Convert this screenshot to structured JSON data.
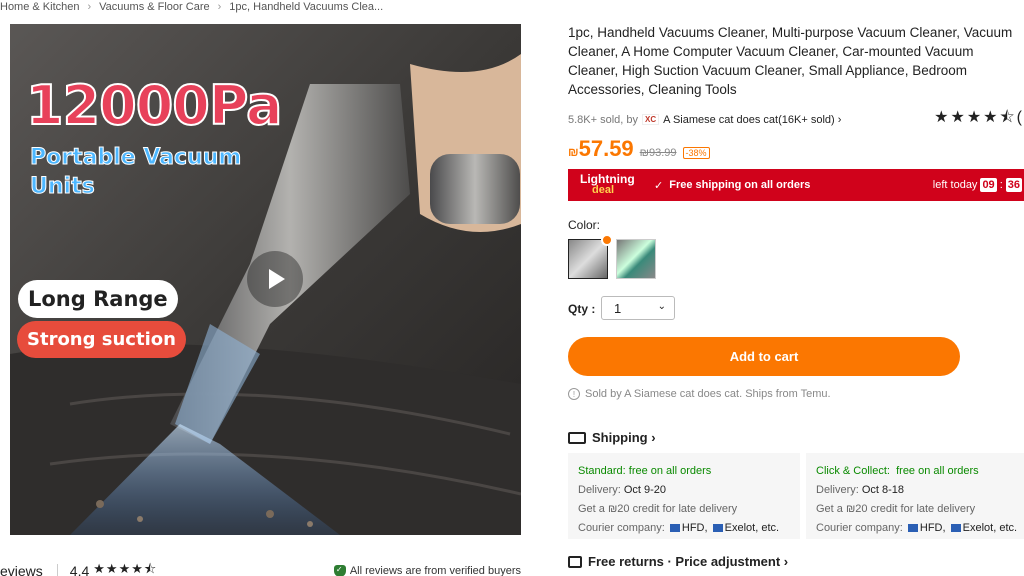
{
  "breadcrumb": [
    "Home & Kitchen",
    "Vacuums & Floor Care",
    "1pc, Handheld Vacuums Clea..."
  ],
  "media": {
    "headline": "12000Pa",
    "subheadline": "Portable Vacuum Units",
    "pill1": "Long Range",
    "pill2": "Strong suction"
  },
  "reviews_bar": {
    "label": "eviews",
    "score": "4.4",
    "stars": "★★★★⯪",
    "verified": "All reviews are from verified buyers"
  },
  "product": {
    "title": "1pc, Handheld Vacuums Cleaner, Multi-purpose Vacuum Cleaner, Vacuum Cleaner, A Home Computer Vacuum Cleaner, Car-mounted Vacuum Cleaner, High Suction Vacuum Cleaner, Small Appliance, Bedroom Accessories, Cleaning Tools",
    "sold": "5.8K+ sold, by",
    "store_badge": "XC",
    "store": "A Siamese cat does cat(16K+ sold)",
    "store_chevron": "›",
    "rating_stars": "★★★★⯪("
  },
  "price": {
    "currency": "₪",
    "current": "57.59",
    "original": "₪93.99",
    "discount": "-38%"
  },
  "deal": {
    "lightning": "Lightning",
    "deal_word": "deal",
    "check": "✓",
    "shipping": "Free shipping on all orders",
    "left_today": "left today",
    "hours": "09",
    "minutes": "36",
    "sep": ":"
  },
  "color": {
    "label": "Color:"
  },
  "qty": {
    "label": "Qty :",
    "value": "1",
    "chevron": "⌄"
  },
  "cart": {
    "label": "Add to cart"
  },
  "soldby": {
    "icon": "!",
    "text": "Sold by A Siamese cat does cat. Ships from Temu."
  },
  "shipping": {
    "heading": "Shipping ›",
    "standard": {
      "title": "Standard: free on all orders",
      "delivery_label": "Delivery:",
      "delivery": "Oct 9-20",
      "credit": "Get a ₪20 credit for late delivery",
      "courier_label": "Courier company:",
      "courier_1": "HFD,",
      "courier_2": "Exelot,",
      "courier_etc": "etc."
    },
    "collect": {
      "title": "Click & Collect:",
      "title2": "free on all orders",
      "delivery_label": "Delivery:",
      "delivery": "Oct 8-18",
      "credit": "Get a ₪20 credit for late delivery",
      "courier_label": "Courier company:",
      "courier_1": "HFD,",
      "courier_2": "Exelot,",
      "courier_etc": "etc."
    }
  },
  "returns": {
    "label": "Free returns · Price adjustment ›"
  },
  "colors": {
    "accent": "#fb7701",
    "deal_red": "#d0021b",
    "green": "#0a8a00"
  }
}
